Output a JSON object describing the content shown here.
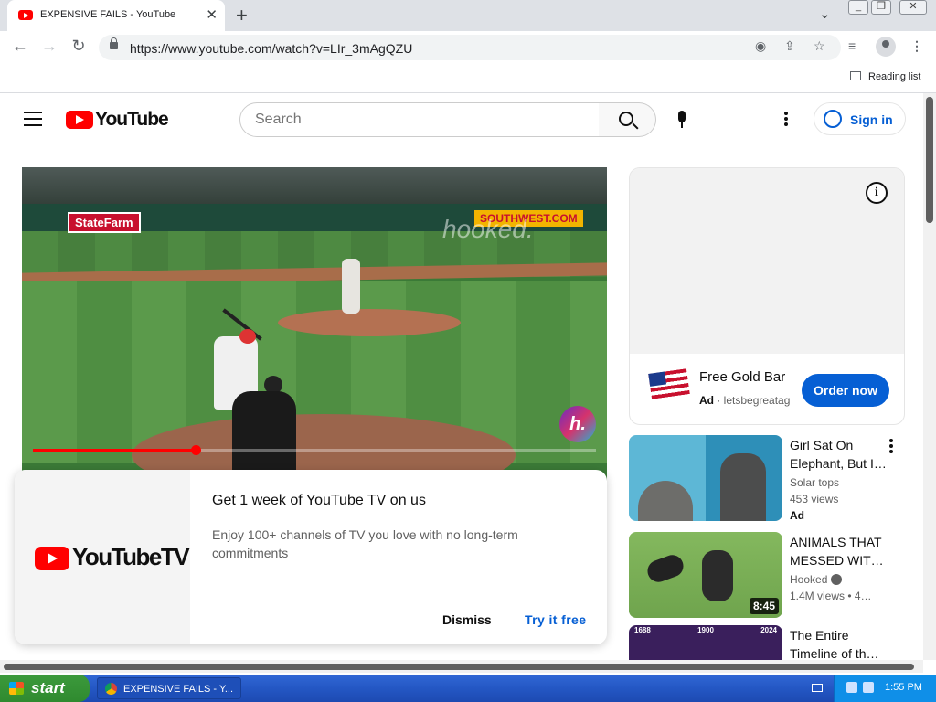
{
  "browser": {
    "tab_title": "EXPENSIVE FAILS - YouTube",
    "new_tab": "+",
    "url": "https://www.youtube.com/watch?v=LIr_3mAgQZU",
    "reading_list": "Reading list"
  },
  "youtube": {
    "logo_text": "YouTube",
    "search_placeholder": "Search",
    "sign_in": "Sign in"
  },
  "player": {
    "statefarm": "StateFarm",
    "southwest": "SOUTHWEST.COM",
    "watermark": "hooked.",
    "badge": "h.",
    "progress_fraction": 0.29
  },
  "promo": {
    "brand": "YouTubeTV",
    "headline": "Get 1 week of YouTube TV on us",
    "body": "Enjoy 100+ channels of TV you love with no long-term commitments",
    "dismiss": "Dismiss",
    "try": "Try it free"
  },
  "ad": {
    "title": "Free Gold Bar",
    "ad_label": "Ad",
    "domain": "letsbegreatag",
    "cta": "Order now"
  },
  "recommendations": [
    {
      "title": "Girl Sat On Elephant, But I…",
      "channel": "Solar tops",
      "views": "453 views",
      "ad_label": "Ad"
    },
    {
      "title": "ANIMALS THAT MESSED WIT…",
      "channel": "Hooked",
      "views": "1.4M views  • 4…",
      "duration": "8:45"
    },
    {
      "title": "The Entire Timeline of th…",
      "years": [
        "1688",
        "1900",
        "2024"
      ]
    }
  ],
  "taskbar": {
    "start": "start",
    "window_item": "EXPENSIVE FAILS - Y...",
    "clock": "1:55 PM"
  }
}
